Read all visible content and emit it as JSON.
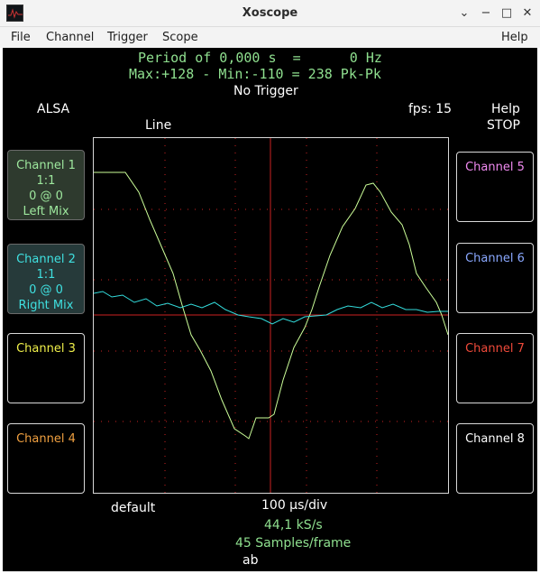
{
  "window": {
    "title": "Xoscope"
  },
  "menu": [
    "File",
    "Channel",
    "Trigger",
    "Scope",
    "Help"
  ],
  "measurements": {
    "period_line": "Period of 0,000 s  =      0 Hz",
    "pk_line": "Max:+128 - Min:-110 = 238 Pk-Pk",
    "trigger": "No Trigger",
    "source": "ALSA",
    "fps": "fps: 15",
    "help": "Help",
    "stop": "STOP",
    "line_mode": "Line"
  },
  "channels_left": [
    {
      "title": "Channel 1",
      "scale": "1:1",
      "pos": "0 @ 0",
      "source": "Left Mix",
      "color": "#9ee89e"
    },
    {
      "title": "Channel 2",
      "scale": "1:1",
      "pos": "0 @ 0",
      "source": "Right Mix",
      "color": "#3fe0e0"
    },
    {
      "title": "Channel 3",
      "color": "#f0f04a"
    },
    {
      "title": "Channel 4",
      "color": "#f0a040"
    }
  ],
  "channels_right": [
    {
      "title": "Channel 5",
      "color": "#f08af0"
    },
    {
      "title": "Channel 6",
      "color": "#8aa8ff"
    },
    {
      "title": "Channel 7",
      "color": "#f04a3a"
    },
    {
      "title": "Channel 8",
      "color": "#ffffff"
    }
  ],
  "bottom": {
    "profile": "default",
    "timebase": "100 µs/div",
    "sample_rate": "44,1 kS/s",
    "samples": "45 Samples/frame",
    "mode": "ab"
  },
  "scope_colors": {
    "grid": "#cc2222",
    "ch1": "#ccff99",
    "ch2": "#33dddd"
  }
}
